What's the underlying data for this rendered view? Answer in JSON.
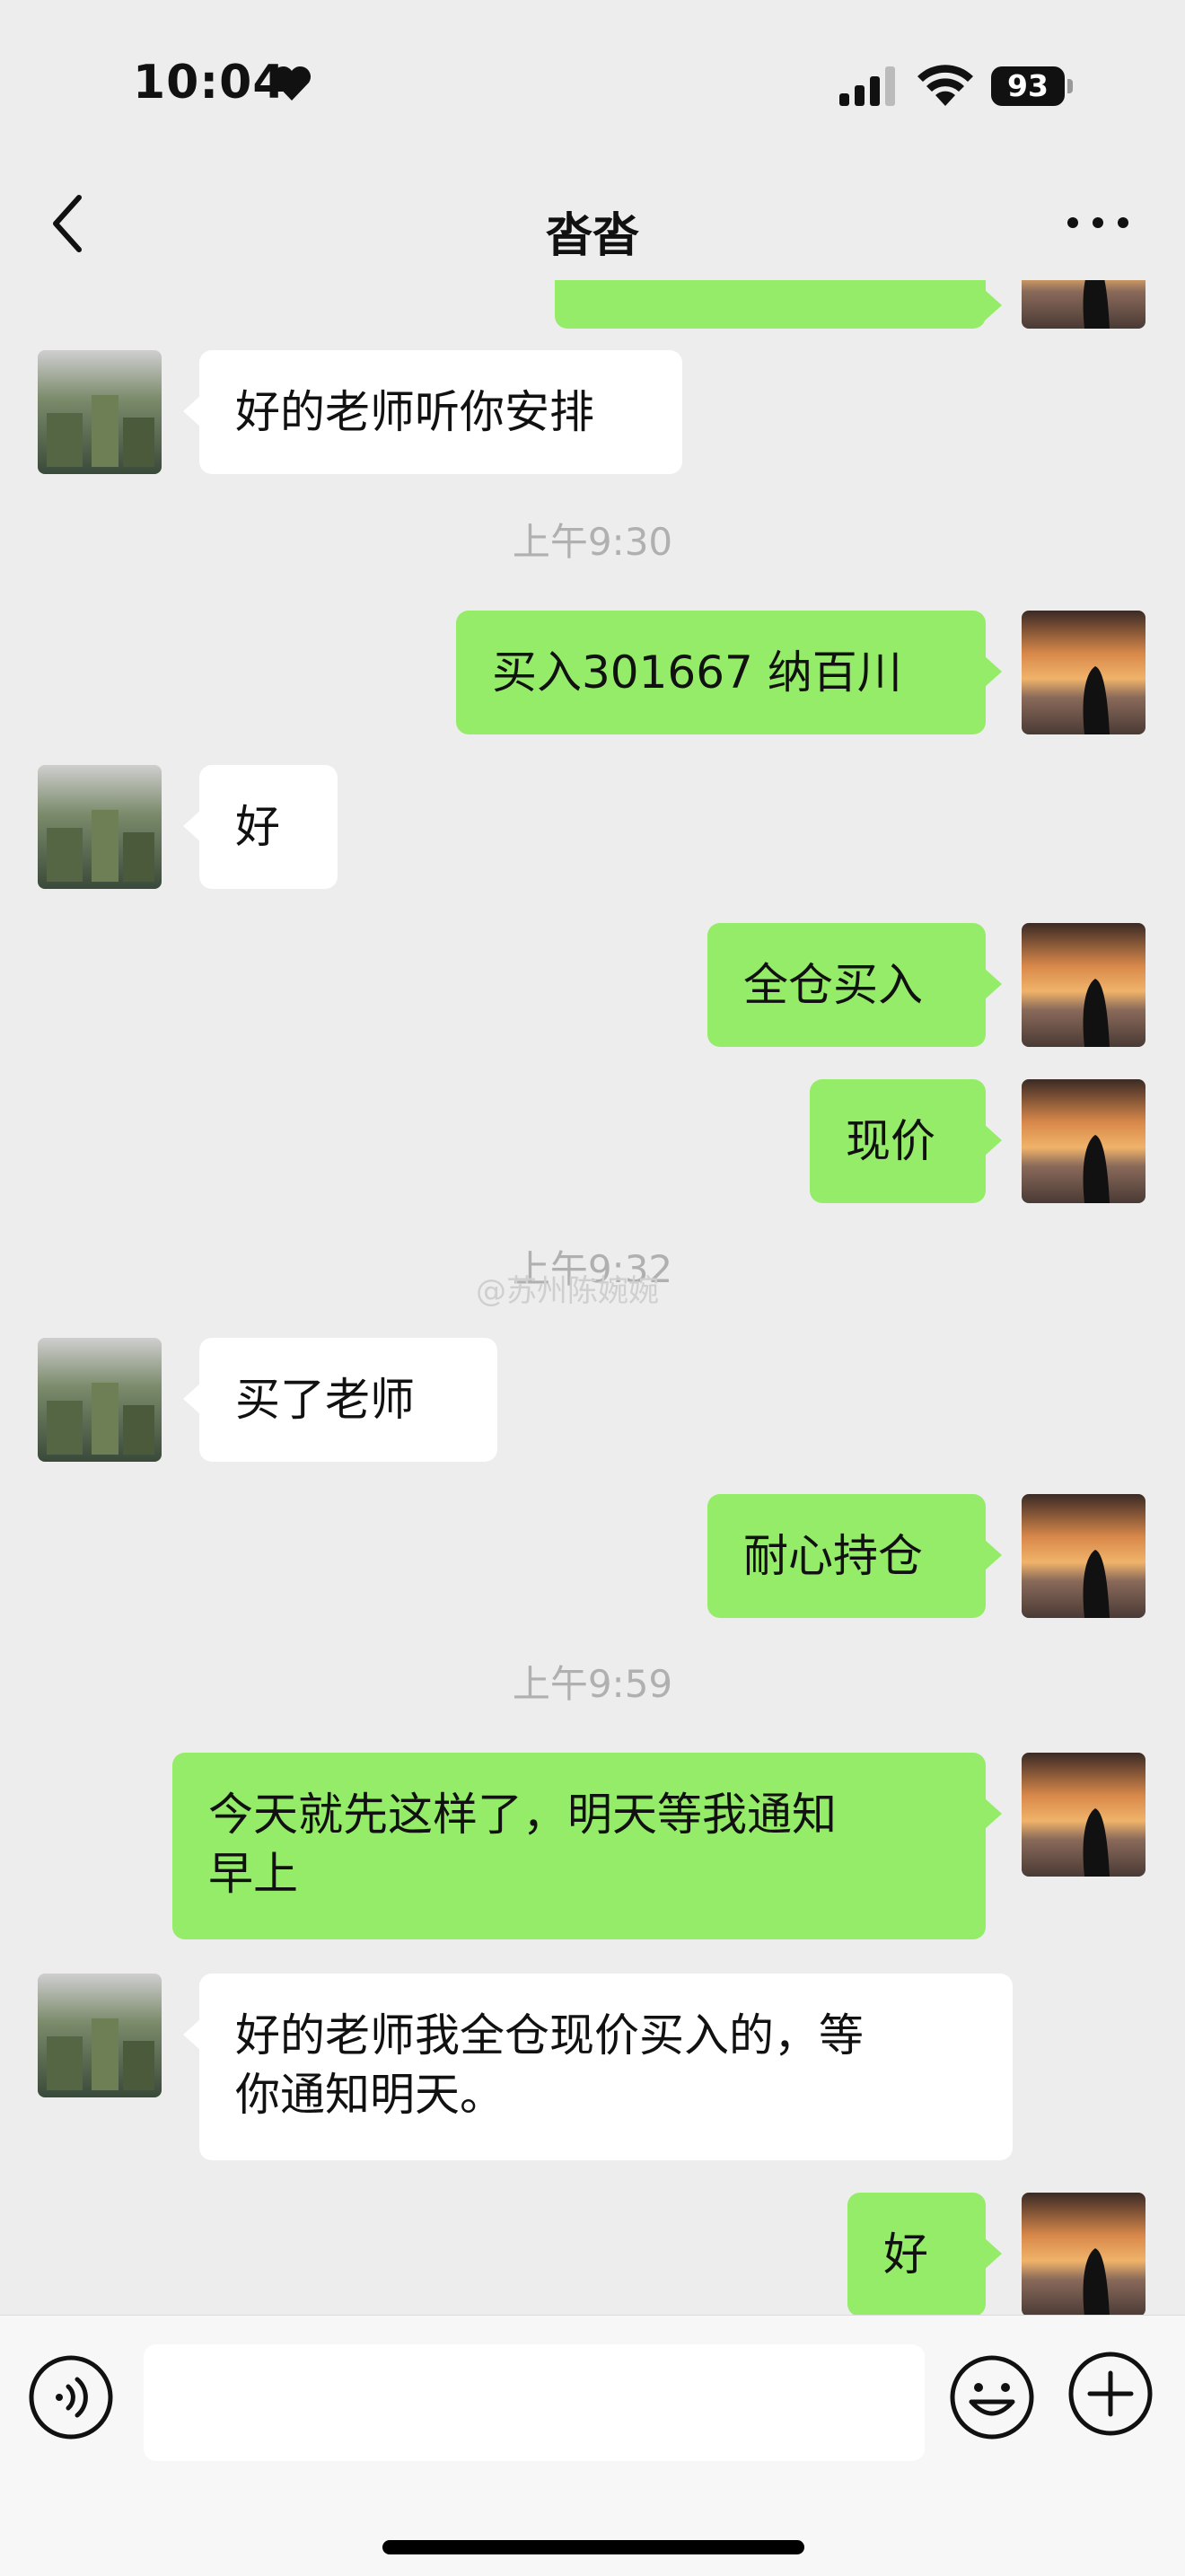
{
  "status_bar": {
    "time": "10:04",
    "battery": "93"
  },
  "nav": {
    "title": "沓沓"
  },
  "messages": [
    {
      "side": "left",
      "text": "好的老师听你安排"
    },
    {
      "time": "上午9:30"
    },
    {
      "side": "right",
      "text": "买入301667 纳百川"
    },
    {
      "side": "left",
      "text": "好"
    },
    {
      "side": "right",
      "text": "全仓买入"
    },
    {
      "side": "right",
      "text": "现价"
    },
    {
      "time": "上午9:32"
    },
    {
      "side": "left",
      "text": "买了老师"
    },
    {
      "side": "right",
      "text": "耐心持仓"
    },
    {
      "time": "上午9:59"
    },
    {
      "side": "right",
      "text": "今天就先这样了，明天等我通知\n早上"
    },
    {
      "side": "left",
      "text": "好的老师我全仓现价买入的，等\n你通知明天。"
    },
    {
      "side": "right",
      "text": "好"
    }
  ],
  "watermark": "@苏州陈婉婉",
  "input": {
    "value": "",
    "placeholder": ""
  },
  "icons": {
    "back": "chevron-left-icon",
    "more": "more-dots-icon",
    "voice": "voice-icon",
    "emoji": "emoji-icon",
    "plus": "plus-icon"
  },
  "colors": {
    "background": "#ededed",
    "sent_bubble": "#95ec69",
    "received_bubble": "#ffffff"
  }
}
